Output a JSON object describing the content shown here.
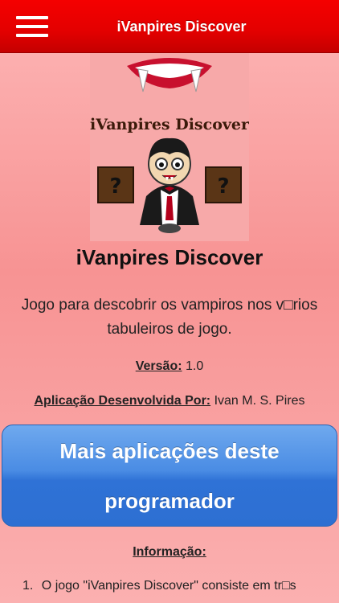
{
  "header": {
    "menu_icon": "hamburger-menu-icon",
    "title": "iVanpires Discover"
  },
  "logo": {
    "caption": "iVanpires Discover",
    "mystery_glyph": "?",
    "colors": {
      "background": "#f7a9a9",
      "box": "#5a3516",
      "lips": "#c8102e",
      "cape": "#1a1a1a"
    }
  },
  "app": {
    "name": "iVanpires Discover",
    "description": "Jogo para descobrir os vampiros nos v□rios tabuleiros de jogo.",
    "version_label": "Versão:",
    "version_value": "1.0",
    "developer_label": "Aplicação Desenvolvida Por:",
    "developer_value": "Ivan M. S. Pires"
  },
  "more_apps_button": {
    "label": "Mais aplicações deste programador"
  },
  "information": {
    "heading": "Informação:",
    "items": [
      {
        "number": "1.",
        "text": "O jogo \"iVanpires Discover\" consiste em tr□s"
      }
    ]
  },
  "colors": {
    "header": "#e30000",
    "background": "#f79393",
    "button": "#3a7ddc"
  }
}
